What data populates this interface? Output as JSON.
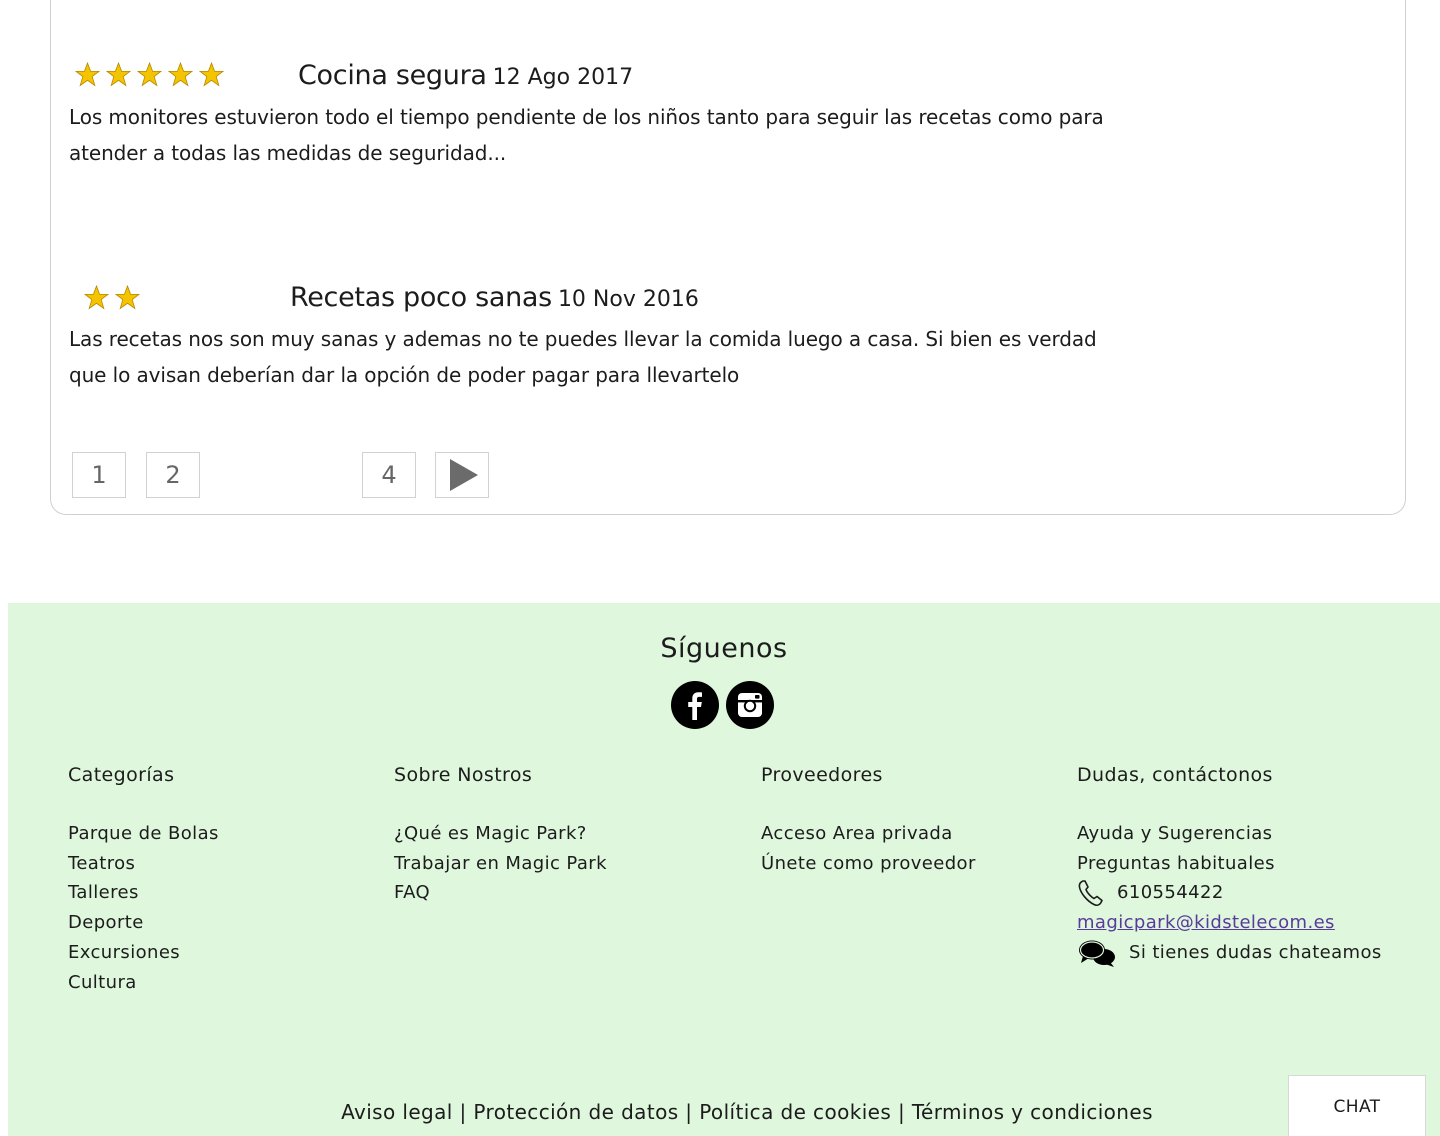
{
  "reviews": [
    {
      "rating": 5,
      "title": "Cocina segura",
      "date": "12 Ago 2017",
      "text": " Los monitores estuvieron todo el tiempo pendiente de los niños tanto para seguir las recetas como para atender a todas las medidas de seguridad..."
    },
    {
      "rating": 2,
      "title": "Recetas poco sanas",
      "date": "10 Nov 2016",
      "text": "Las recetas nos son muy sanas y ademas no te puedes llevar la comida luego a casa. Si bien es verdad que lo avisan deberían dar la opción de poder pagar para llevartelo"
    }
  ],
  "pagination": {
    "pages": [
      "1",
      "2",
      "4"
    ],
    "next_icon": "play-icon"
  },
  "colors": {
    "star": "#f5c400",
    "footer_bg": "#dff7dd",
    "link_email": "#5a3a9a"
  },
  "footer": {
    "follow_title": "Síguenos",
    "social": [
      "facebook-icon",
      "instagram-icon"
    ],
    "columns": [
      {
        "heading": "Categorías",
        "links": [
          "Parque de Bolas",
          "Teatros",
          "Talleres",
          "Deporte",
          "Excursiones",
          "Cultura"
        ]
      },
      {
        "heading": "Sobre Nostros",
        "links": [
          "¿Qué es Magic Park?",
          "Trabajar en Magic Park",
          "FAQ"
        ]
      },
      {
        "heading": "Proveedores",
        "links": [
          "Acceso Area privada",
          "Únete como proveedor"
        ]
      },
      {
        "heading": "Dudas, contáctonos",
        "links": [
          "Ayuda y Sugerencias",
          "Preguntas habituales"
        ],
        "phone": "610554422",
        "email": "magicpark@kidstelecom.es",
        "chat_text": "Si tienes dudas chateamos"
      }
    ],
    "legal": {
      "aviso": "Aviso legal",
      "proteccion": "Protección de datos",
      "cookies": "Política de cookies",
      "terminos": "Términos y condiciones",
      "separator": " | "
    }
  },
  "chat_button": "CHAT"
}
